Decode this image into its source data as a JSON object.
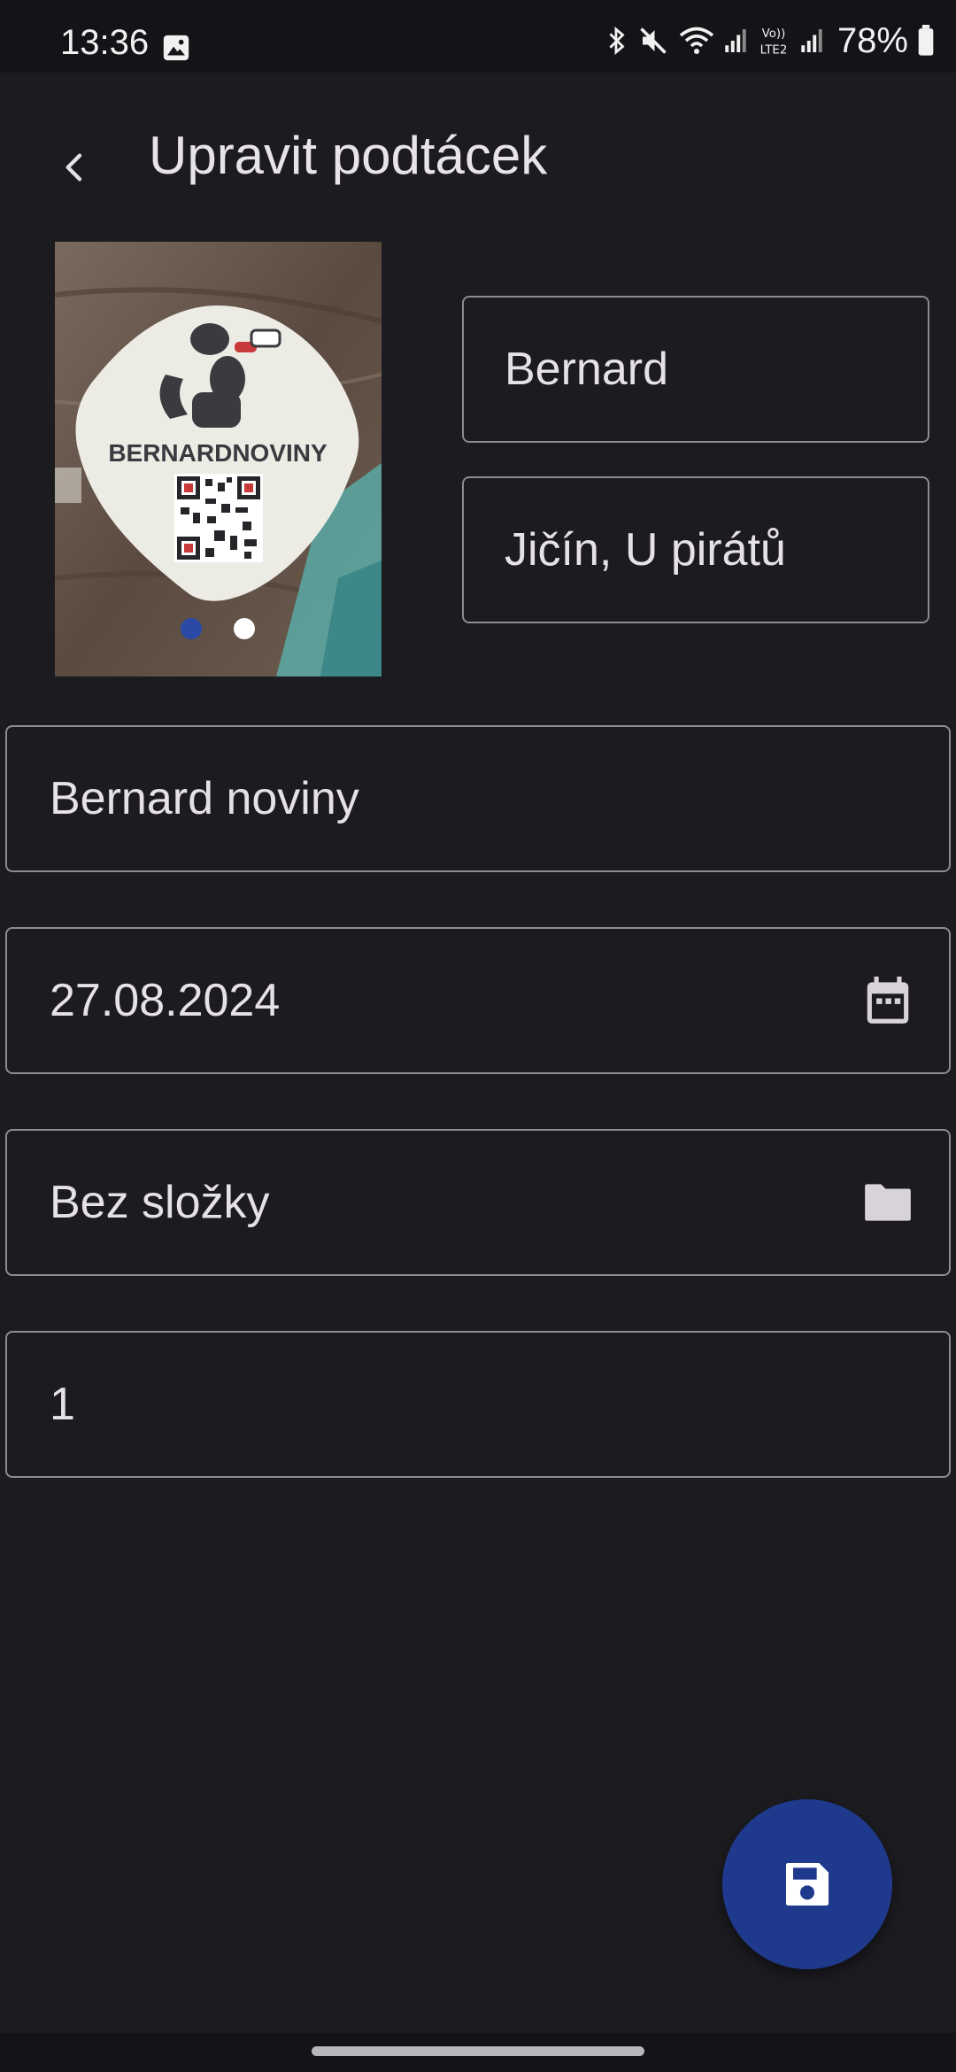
{
  "status_bar": {
    "time": "13:36",
    "battery": "78%",
    "icons": [
      "image-icon",
      "bluetooth-icon",
      "mute-icon",
      "wifi-icon",
      "signal-icon",
      "volte-lte2-icon",
      "signal-icon",
      "battery-icon"
    ]
  },
  "app_bar": {
    "title": "Upravit podtácek",
    "back_icon": "back-arrow-icon"
  },
  "photo": {
    "logo_text": "BERNARDNOVINY",
    "carousel_count": 2,
    "carousel_active_index": 0,
    "colors": {
      "active_dot": "#2b4aa8",
      "inactive_dot": "#ffffff"
    }
  },
  "form": {
    "brand": "Bernard",
    "place": "Jičín, U pirátů",
    "name": "Bernard noviny",
    "date": "27.08.2024",
    "folder": "Bez složky",
    "count": "1",
    "date_icon": "calendar-icon",
    "folder_icon": "folder-icon"
  },
  "fab": {
    "icon": "save-icon",
    "color": "#1f3a8c"
  }
}
